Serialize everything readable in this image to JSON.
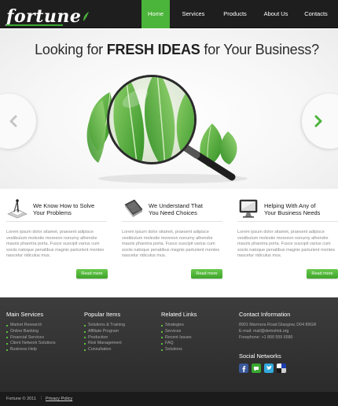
{
  "brand": {
    "name": "fortune"
  },
  "nav": {
    "items": [
      {
        "label": "Home",
        "active": true
      },
      {
        "label": "Services",
        "active": false
      },
      {
        "label": "Products",
        "active": false
      },
      {
        "label": "About Us",
        "active": false
      },
      {
        "label": "Contacts",
        "active": false
      }
    ]
  },
  "hero": {
    "title_prefix": "Looking for",
    "title_bold": "FRESH IDEAS",
    "title_suffix": "for Your Business?",
    "prev_icon": "chevron-left-icon",
    "next_icon": "chevron-right-icon"
  },
  "features": [
    {
      "icon": "drawing-tools-icon",
      "title_line1": "We Know How to Solve",
      "title_line2": "Your Problems",
      "text": "Lorem ipsum dolor sitamet, praesent adipisce vestibulum molestie moreeon nonumy alhendre mauris pharetra porta. Fusce suscipit varius cum sociis natoque penatibus magnis parturient montes nascetur ridiculus mus.",
      "button": "Read more"
    },
    {
      "icon": "notebook-icon",
      "title_line1": "We Understand That",
      "title_line2": "You Need Choices",
      "text": "Lorem ipsum dolor sitamet, praesent adipisce vestibulum molestie moreeon nonumy alhendre mauris pharetra porta. Fusce suscipit varius cum sociis natoque penatibus magnis parturient montes nascetur ridiculus mus.",
      "button": "Read more"
    },
    {
      "icon": "monitor-icon",
      "title_line1": "Helping With Any of",
      "title_line2": "Your Business Needs",
      "text": "Lorem ipsum dolor sitamet, praesent adipisce vestibulum molestie moreeon nonumy alhendre mauris pharetra porta. Fusce suscipit varius cum sociis natoque penatibus magnis parturient montes nascetur ridiculus mus.",
      "button": "Read more"
    }
  ],
  "footer": {
    "main_services": {
      "title": "Main Services",
      "items": [
        "Market Research",
        "Online Banking",
        "Financial Services",
        "Client Network Solutions",
        "Business Help"
      ]
    },
    "popular_items": {
      "title": "Popular Items",
      "items": [
        "Solutions & Training",
        "Affiliate Program",
        "Production",
        "Risk Management",
        "Consultation"
      ]
    },
    "related_links": {
      "title": "Related Links",
      "items": [
        "Strategies",
        "Services",
        "Recent Issues",
        "FAQ",
        "Solutions"
      ]
    },
    "contact": {
      "title": "Contact Information",
      "address": "8901 Marmora Road Glasgow, D04 89GR",
      "email": "E-mail: mail@demolink.org",
      "phone": "Freephone:  +1 800 559 6580"
    },
    "social": {
      "title": "Social Networks",
      "icons": [
        "facebook-icon",
        "share-icon",
        "twitter-icon",
        "delicious-icon"
      ]
    }
  },
  "bottom": {
    "copyright": "Fortune © 2011",
    "separator": "|",
    "privacy": "Privacy Policy"
  },
  "colors": {
    "accent_green": "#4bb43a",
    "header_bg": "#1e1e1e",
    "footer_bg": "#333333"
  }
}
